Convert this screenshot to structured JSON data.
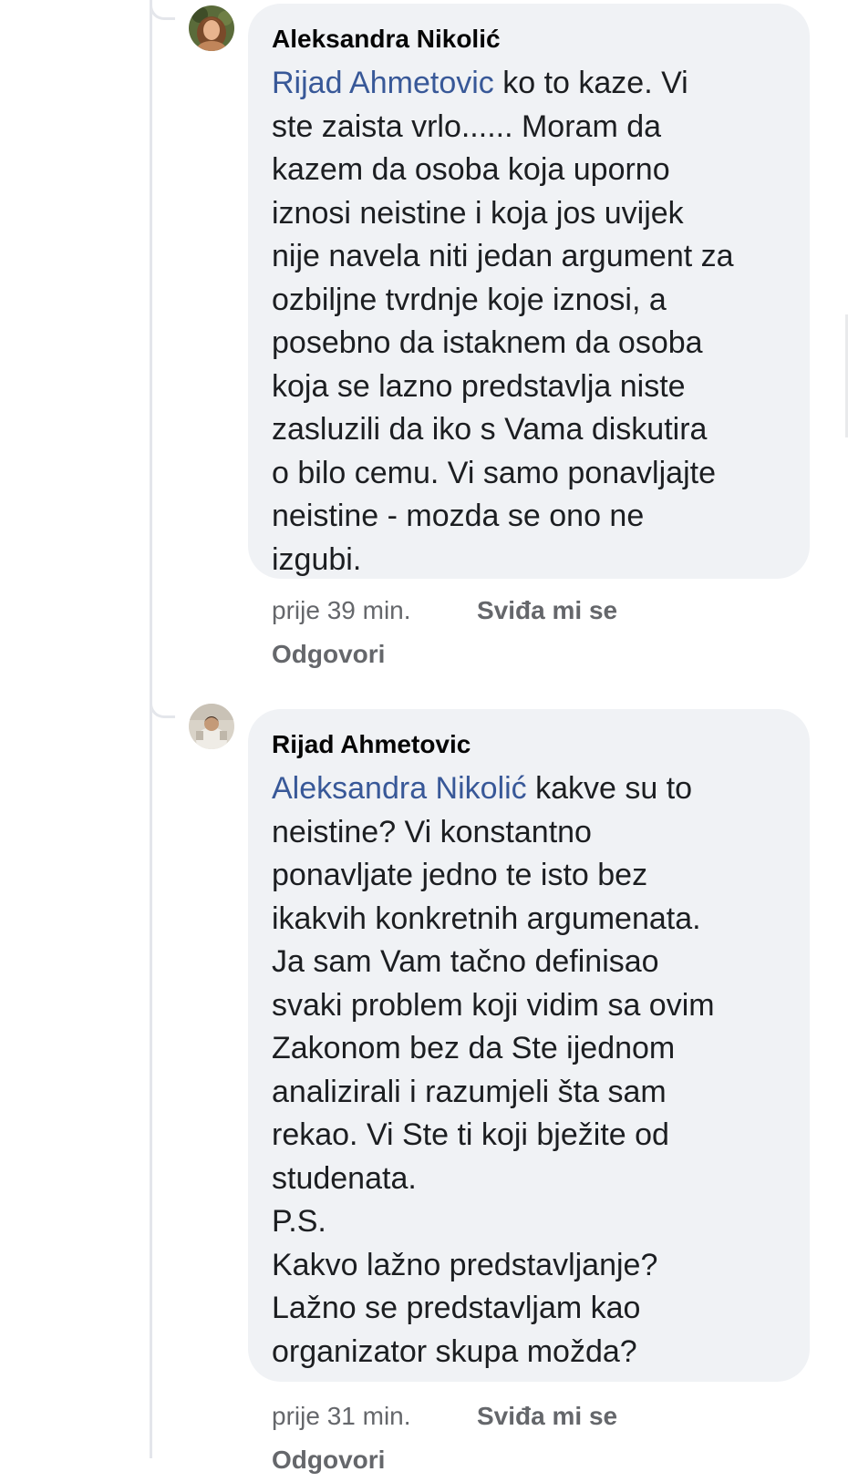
{
  "comments": [
    {
      "author": "Aleksandra Nikolić",
      "mention": "Rijad Ahmetovic",
      "text": " ko to kaze. Vi\nste zaista vrlo...... Moram da\nkazem da osoba koja uporno\niznosi neistine i koja jos uvijek\nnije navela niti jedan argument za\nozbiljne tvrdnje koje iznosi, a\nposebno da istaknem da osoba\nkoja se lazno predstavlja niste\nzasluzili da iko s Vama diskutira\no bilo cemu. Vi samo ponavljajte\nneistine - mozda se ono ne\nizgubi.",
      "time": "prije 39 min.",
      "like_label": "Sviđa mi se",
      "reply_label": "Odgovori",
      "avatar_icon": "user-photo-avatar-woman"
    },
    {
      "author": "Rijad Ahmetovic",
      "mention": "Aleksandra Nikolić",
      "text": " kakve su to\nneistine? Vi konstantno\nponavljate jedno te isto bez\nikakvih konkretnih argumenata.\nJa sam Vam tačno definisao\nsvaki problem koji vidim sa ovim\nZakonom bez da Ste ijednom\nanalizirali i razumjeli šta sam\nrekao. Vi Ste ti koji bježite od\nstudenata.\nP.S.\nKakvo lažno predstavljanje?\nLažno se predstavljam kao\norganizator skupa možda?",
      "time": "prije 31 min.",
      "like_label": "Sviđa mi se",
      "reply_label": "Odgovori",
      "avatar_icon": "user-photo-avatar-man"
    }
  ],
  "colors": {
    "bubble": "#f0f2f5",
    "mention": "#385898",
    "meta": "#65676b",
    "thread_line": "#e4e6eb"
  }
}
